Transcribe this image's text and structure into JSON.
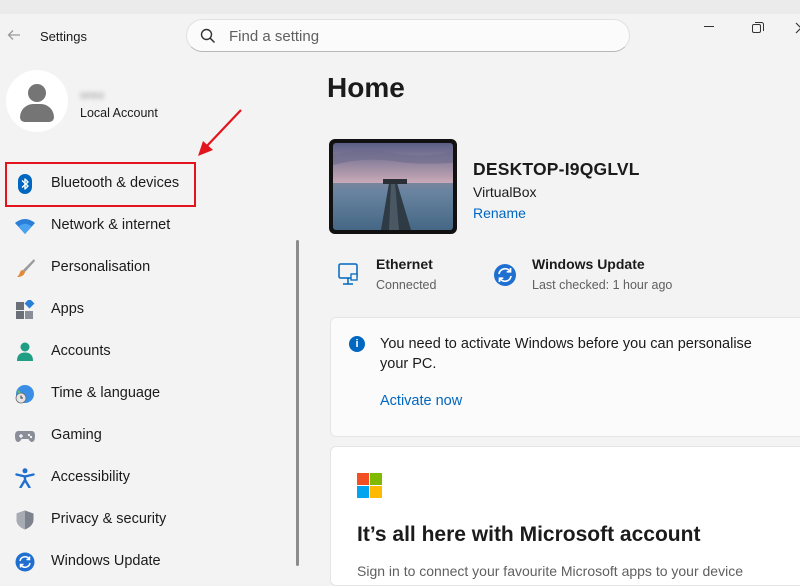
{
  "window": {
    "title": "Settings",
    "colors": {
      "accent": "#0067c0",
      "highlight_box": "#e3141b",
      "background": "#f3f3f3"
    }
  },
  "search": {
    "placeholder": "Find a setting"
  },
  "profile": {
    "name": "oreo",
    "account_type": "Local Account"
  },
  "sidebar": {
    "items": [
      {
        "label": "Bluetooth & devices",
        "icon": "bluetooth-icon"
      },
      {
        "label": "Network & internet",
        "icon": "wifi-icon"
      },
      {
        "label": "Personalisation",
        "icon": "brush-icon"
      },
      {
        "label": "Apps",
        "icon": "apps-icon"
      },
      {
        "label": "Accounts",
        "icon": "accounts-icon"
      },
      {
        "label": "Time & language",
        "icon": "globe-clock-icon"
      },
      {
        "label": "Gaming",
        "icon": "gamepad-icon"
      },
      {
        "label": "Accessibility",
        "icon": "accessibility-icon"
      },
      {
        "label": "Privacy & security",
        "icon": "shield-icon"
      },
      {
        "label": "Windows Update",
        "icon": "update-icon"
      }
    ]
  },
  "main": {
    "title": "Home",
    "device": {
      "name": "DESKTOP-I9QGLVL",
      "model": "VirtualBox",
      "rename_label": "Rename"
    },
    "status": [
      {
        "title": "Ethernet",
        "subtitle": "Connected",
        "icon": "ethernet-icon"
      },
      {
        "title": "Windows Update",
        "subtitle": "Last checked: 1 hour ago",
        "icon": "update-icon"
      }
    ],
    "notice": {
      "message": "You need to activate Windows before you can personalise your PC.",
      "action": "Activate now"
    },
    "ms_card": {
      "title": "It’s all here with Microsoft account",
      "subtitle": "Sign in to connect your favourite Microsoft apps to your device"
    }
  }
}
